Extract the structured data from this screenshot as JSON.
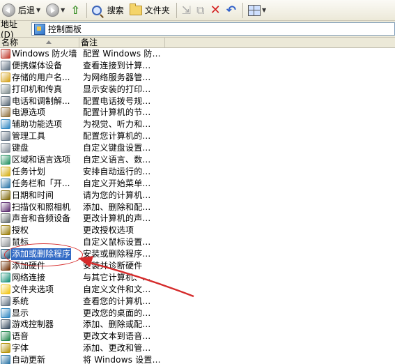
{
  "toolbar": {
    "back_label": "后退",
    "search_label": "搜索",
    "folders_label": "文件夹"
  },
  "address": {
    "label": "地址 (D)",
    "value": "控制面板"
  },
  "columns": {
    "name": "名称",
    "description": "备注"
  },
  "items": [
    {
      "name": "Windows 防火墙",
      "desc": "配置 Windows 防...",
      "color": "#c0392b"
    },
    {
      "name": "便携媒体设备",
      "desc": "查看连接到计算...",
      "color": "#5d6d7e"
    },
    {
      "name": "存储的用户名...",
      "desc": "为网络服务器管...",
      "color": "#d4a017"
    },
    {
      "name": "打印机和传真",
      "desc": "显示安装的打印...",
      "color": "#7f8c8d"
    },
    {
      "name": "电话和调制解...",
      "desc": "配置电话拨号规...",
      "color": "#566573"
    },
    {
      "name": "电源选项",
      "desc": "配置计算机的节...",
      "color": "#8e6e3a"
    },
    {
      "name": "辅助功能选项",
      "desc": "为视觉、听力和...",
      "color": "#2e86c1"
    },
    {
      "name": "管理工具",
      "desc": "配置您计算机的...",
      "color": "#6c7a89"
    },
    {
      "name": "键盘",
      "desc": "自定义键盘设置...",
      "color": "#808b96"
    },
    {
      "name": "区域和语言选项",
      "desc": "自定义语言、数...",
      "color": "#1f8f5f"
    },
    {
      "name": "任务计划",
      "desc": "安排自动运行的...",
      "color": "#d4ac0d"
    },
    {
      "name": "任务栏和「开...",
      "desc": "自定义开始菜单...",
      "color": "#2874a6"
    },
    {
      "name": "日期和时间",
      "desc": "请为您的计算机...",
      "color": "#7d6608"
    },
    {
      "name": "扫描仪和照相机",
      "desc": "添加、删除和配...",
      "color": "#5b2c6f"
    },
    {
      "name": "声音和音频设备",
      "desc": "更改计算机的声...",
      "color": "#616a6b"
    },
    {
      "name": "授权",
      "desc": "更改授权选项",
      "color": "#9a7d0a"
    },
    {
      "name": "鼠标",
      "desc": "自定义鼠标设置...",
      "color": "#909497"
    },
    {
      "name": "添加或删除程序",
      "desc": "安装或删除程序...",
      "color": "#1a5276",
      "selected": true
    },
    {
      "name": "添加硬件",
      "desc": "安装并诊断硬件",
      "color": "#6e2c00"
    },
    {
      "name": "网络连接",
      "desc": "与其它计算机、...",
      "color": "#148f77"
    },
    {
      "name": "文件夹选项",
      "desc": "自定义文件和文...",
      "color": "#f1c40f"
    },
    {
      "name": "系统",
      "desc": "查看您的计算机...",
      "color": "#5d6d7e"
    },
    {
      "name": "显示",
      "desc": "更改您的桌面的...",
      "color": "#2e86c1"
    },
    {
      "name": "游戏控制器",
      "desc": "添加、删除或配...",
      "color": "#34495e"
    },
    {
      "name": "语音",
      "desc": "更改文本到语音...",
      "color": "#1e8449"
    },
    {
      "name": "字体",
      "desc": "添加、更改和管...",
      "color": "#b7950b"
    },
    {
      "name": "自动更新",
      "desc": "将 Windows 设置...",
      "color": "#2471a3"
    }
  ]
}
